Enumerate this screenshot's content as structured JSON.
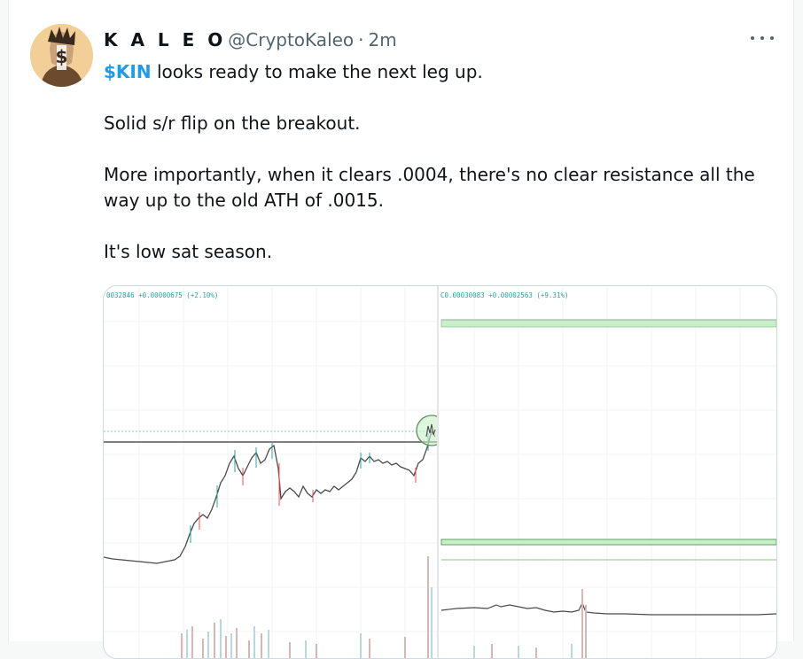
{
  "tweet": {
    "display_name": "K A L E O",
    "handle": "@CryptoKaleo",
    "separator": "·",
    "timestamp": "2m",
    "cashtag": "$KIN",
    "line1_rest": " looks ready to make the next leg up.",
    "line2": "Solid s/r flip on the breakout.",
    "line3": "More importantly, when it clears .0004, there's no clear resistance all the way up to the old ATH of .0015.",
    "line4": "It's low sat season."
  },
  "media": {
    "left_chart_label": "0032846 +0.00000675 (+2.10%)",
    "right_chart_label": "C0.00030083 +0.00002563 (+9.31%)"
  },
  "colors": {
    "accent": "#1d9bf0",
    "up_candle": "#26a69a",
    "down_candle": "#ef5350",
    "zone_fill": "#c8f0c8"
  },
  "icons": {
    "more": "more-dots-icon",
    "avatar": "avatar-image"
  }
}
